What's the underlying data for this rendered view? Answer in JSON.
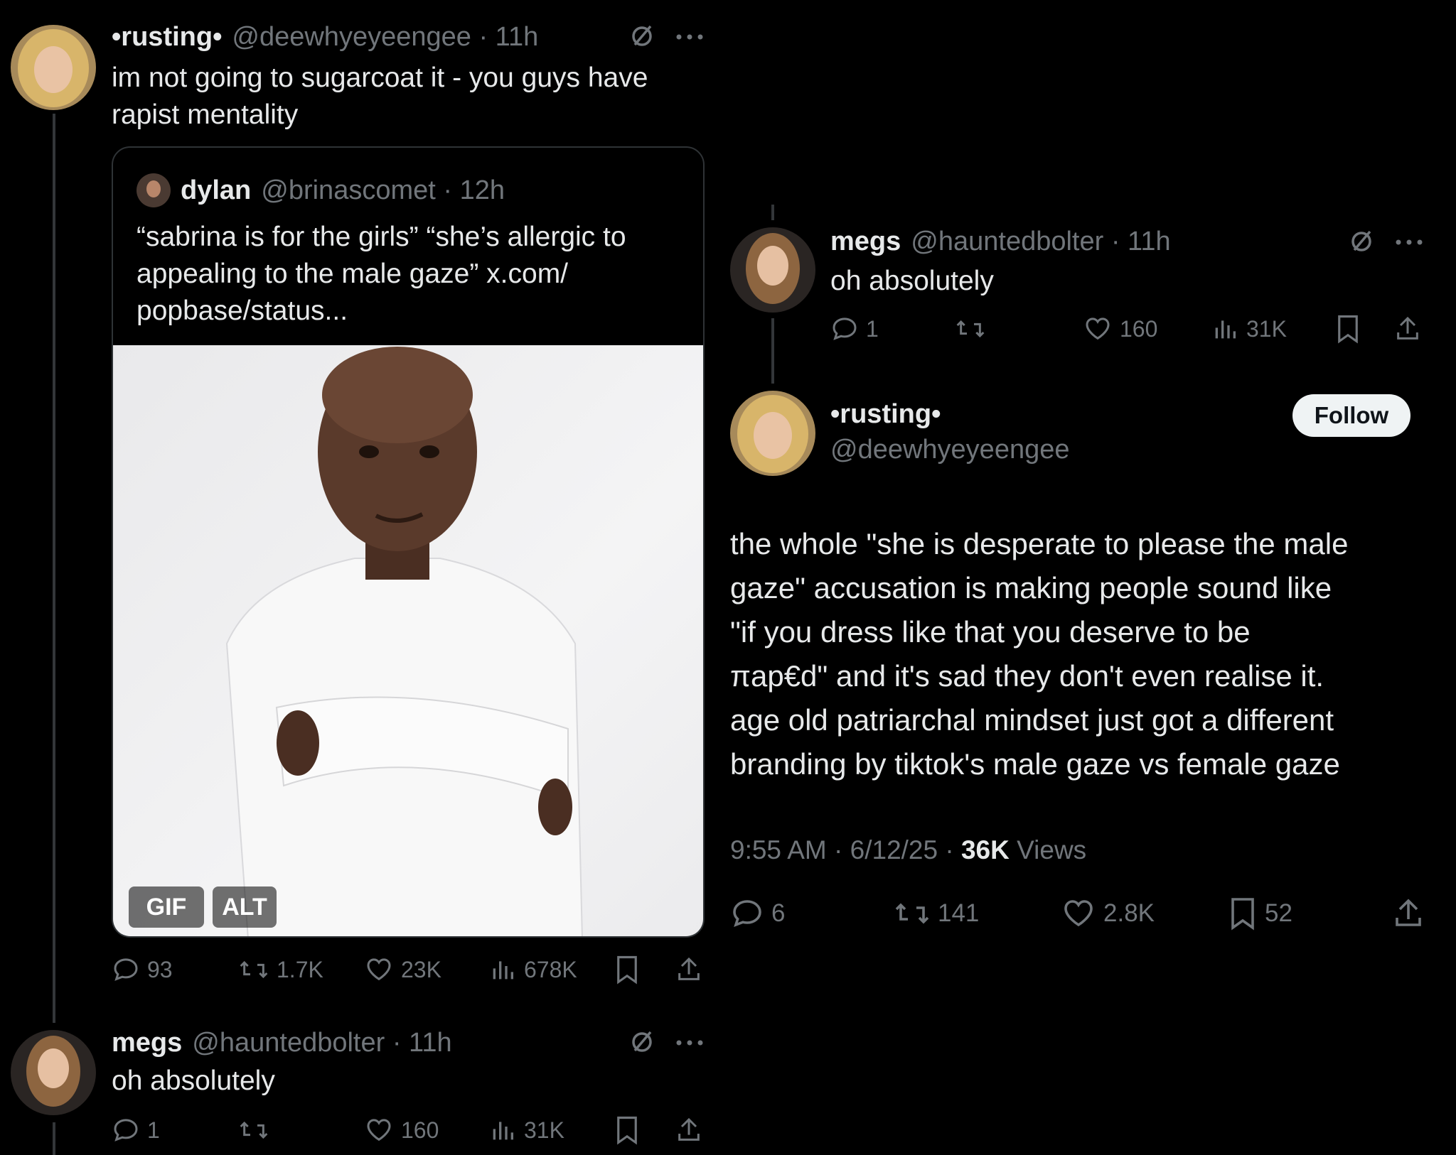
{
  "left": {
    "tweet": {
      "display_name": "•rusting•",
      "handle_time": "@deewhyeyeengee · 11h",
      "text_line1": "im not going to sugarcoat it - you guys have",
      "text_line2": "rapist mentality"
    },
    "quote": {
      "display_name": "dylan",
      "handle_time": "@brinascomet · 12h",
      "text_line1": "“sabrina is for the girls” “she’s allergic to",
      "text_line2": "appealing to the male gaze” x.com/",
      "text_line3": "popbase/status...",
      "gif_label": "GIF",
      "alt_label": "ALT"
    },
    "actions": {
      "replies": "93",
      "reposts": "1.7K",
      "likes": "23K",
      "views": "678K"
    },
    "reply": {
      "display_name": "megs",
      "handle_time": "@hauntedbolter · 11h",
      "text": "oh absolutely",
      "replies": "1",
      "likes": "160",
      "views": "31K"
    }
  },
  "right": {
    "reply": {
      "display_name": "megs",
      "handle_time": "@hauntedbolter · 11h",
      "text": "oh absolutely",
      "replies": "1",
      "likes": "160",
      "views": "31K"
    },
    "main": {
      "display_name": "•rusting•",
      "handle": "@deewhyeyeengee",
      "follow_label": "Follow",
      "text_line1": "the whole \"she is desperate to please the male",
      "text_line2": "gaze\" accusation is making people sound like",
      "text_line3": "\"if you dress like that you deserve to be",
      "text_line4": "πap€d\" and it's sad they don't even realise it.",
      "text_line5": "age old patriarchal mindset just got a different",
      "text_line6": "branding by tiktok's male gaze vs female gaze",
      "time_date": "9:55 AM · 6/12/25 · ",
      "views_count": "36K",
      "views_label": " Views",
      "replies": "6",
      "reposts": "141",
      "likes": "2.8K",
      "bookmarks": "52"
    }
  },
  "colors": {
    "background": "#000000",
    "text": "#e7e9ea",
    "muted": "#71767b",
    "thread_line": "#333639"
  }
}
